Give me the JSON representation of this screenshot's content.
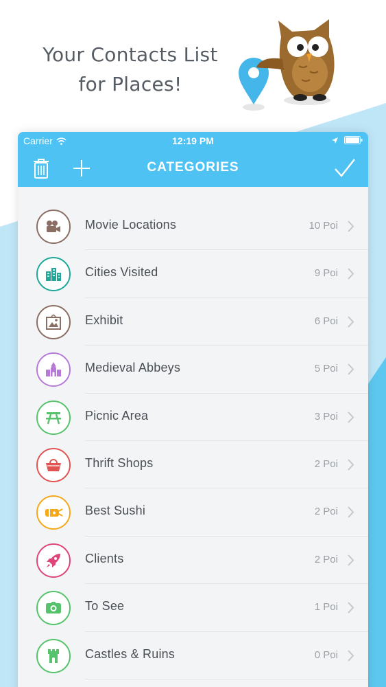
{
  "promo": {
    "tagline_line1": "Your Contacts List",
    "tagline_line2": "for Places!"
  },
  "status_bar": {
    "carrier": "Carrier",
    "time": "12:19 PM",
    "icons": [
      "wifi-icon",
      "location-arrow-icon",
      "battery-icon"
    ]
  },
  "nav": {
    "title": "CATEGORIES",
    "left_actions": [
      "trash-icon",
      "plus-icon"
    ],
    "right_action": "checkmark-icon"
  },
  "colors": {
    "accent": "#4ec2f2",
    "movie": "#8b6e63",
    "cities": "#1fa89a",
    "exhibit": "#8b6e63",
    "abbeys": "#b77ad8",
    "picnic": "#56c26c",
    "thrift": "#e25454",
    "sushi": "#f4a81a",
    "clients": "#e0457a",
    "tosee": "#56c26c",
    "castles": "#56c26c"
  },
  "categories": [
    {
      "label": "Movie Locations",
      "count": "10 Poi",
      "icon": "movie-camera-icon"
    },
    {
      "label": "Cities Visited",
      "count": "9 Poi",
      "icon": "city-buildings-icon"
    },
    {
      "label": "Exhibit",
      "count": "6 Poi",
      "icon": "picture-frame-icon"
    },
    {
      "label": "Medieval Abbeys",
      "count": "5 Poi",
      "icon": "abbey-icon"
    },
    {
      "label": "Picnic Area",
      "count": "3 Poi",
      "icon": "picnic-table-icon"
    },
    {
      "label": "Thrift Shops",
      "count": "2 Poi",
      "icon": "basket-icon"
    },
    {
      "label": "Best Sushi",
      "count": "2 Poi",
      "icon": "sushi-icon"
    },
    {
      "label": "Clients",
      "count": "2 Poi",
      "icon": "rocket-icon"
    },
    {
      "label": "To See",
      "count": "1 Poi",
      "icon": "camera-icon"
    },
    {
      "label": "Castles & Ruins",
      "count": "0 Poi",
      "icon": "castle-icon"
    }
  ]
}
